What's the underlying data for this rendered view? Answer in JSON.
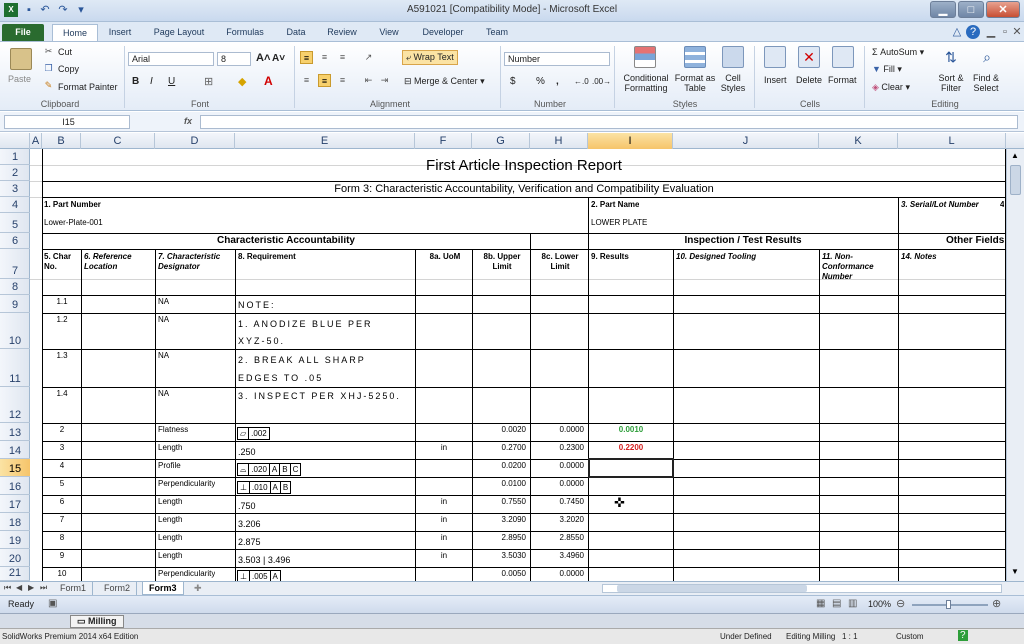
{
  "window": {
    "title": "A591021  [Compatibility Mode]  -  Microsoft Excel"
  },
  "ribbon_tabs": [
    "File",
    "Home",
    "Insert",
    "Page Layout",
    "Formulas",
    "Data",
    "Review",
    "View",
    "Developer",
    "Team"
  ],
  "clipboard": {
    "paste": "Paste",
    "cut": "Cut",
    "copy": "Copy",
    "format_painter": "Format Painter",
    "label": "Clipboard"
  },
  "font": {
    "name": "Arial",
    "size": "8",
    "label": "Font",
    "bold": "B",
    "italic": "I",
    "underline": "U"
  },
  "alignment": {
    "wrap_text": "Wrap Text",
    "merge_center": "Merge & Center",
    "label": "Alignment"
  },
  "number": {
    "format": "Number",
    "label": "Number",
    "currency": "$",
    "percent": "%",
    "comma": ","
  },
  "styles": {
    "conditional": "Conditional Formatting",
    "format_table": "Format as Table",
    "cell_styles": "Cell Styles",
    "label": "Styles"
  },
  "cells": {
    "insert": "Insert",
    "delete": "Delete",
    "format": "Format",
    "label": "Cells"
  },
  "editing": {
    "autosum": "AutoSum",
    "fill": "Fill",
    "clear": "Clear",
    "sort_filter": "Sort & Filter",
    "find_select": "Find & Select",
    "label": "Editing"
  },
  "formula_bar": {
    "name_box": "I15",
    "fx": "fx",
    "value": ""
  },
  "columns": [
    "A",
    "B",
    "C",
    "D",
    "E",
    "F",
    "G",
    "H",
    "I",
    "J",
    "K",
    "L"
  ],
  "rows": [
    "1",
    "2",
    "3",
    "4",
    "5",
    "6",
    "7",
    "8",
    "9",
    "10",
    "11",
    "12",
    "13",
    "14",
    "15",
    "16",
    "17",
    "18",
    "19",
    "20",
    "21"
  ],
  "sheet": {
    "title": "First Article Inspection Report",
    "subtitle": "Form 3: Characteristic Accountability, Verification and Compatibility Evaluation",
    "part_number_label": "1. Part Number",
    "part_number": "Lower-Plate-001",
    "part_name_label": "2. Part Name",
    "part_name": "LOWER PLATE",
    "serial_label": "3. Serial/Lot Number",
    "serial_extra": "4",
    "section_char": "Characteristic Accountability",
    "section_insp": "Inspection / Test Results",
    "section_other": "Other Fields",
    "headers": {
      "char_no": "5. Char No.",
      "ref_loc": "6. Reference Location",
      "char_des": "7. Characteristic Designator",
      "requirement": "8. Requirement",
      "uom": "8a. UoM",
      "upper": "8b. Upper Limit",
      "lower": "8c. Lower Limit",
      "results": "9. Results",
      "tooling": "10. Designed Tooling",
      "nonconf": "11. Non-Conformance Number",
      "notes": "14. Notes"
    },
    "notes_rows": [
      {
        "no": "1.1",
        "des": "NA",
        "req": "NOTE:"
      },
      {
        "no": "1.2",
        "des": "NA",
        "req": "1. ANODIZE BLUE PER",
        "req2": "XYZ-50."
      },
      {
        "no": "1.3",
        "des": "NA",
        "req": "2. BREAK ALL SHARP",
        "req2": "EDGES TO .05"
      },
      {
        "no": "1.4",
        "des": "NA",
        "req": "3. INSPECT PER XHJ-5250."
      }
    ],
    "data_rows": [
      {
        "no": "2",
        "des": "Flatness",
        "gdt": [
          "▱",
          ".002"
        ],
        "uom": "",
        "upper": "0.0020",
        "lower": "0.0000",
        "result": "0.0010",
        "result_color": "#2e9e3a"
      },
      {
        "no": "3",
        "des": "Length",
        "req": ".250",
        "uom": "in",
        "upper": "0.2700",
        "lower": "0.2300",
        "result": "0.2200",
        "result_color": "#d42020"
      },
      {
        "no": "4",
        "des": "Profile",
        "gdt": [
          "⌓",
          ".020",
          "A",
          "B",
          "C"
        ],
        "uom": "",
        "upper": "0.0200",
        "lower": "0.0000",
        "result": ""
      },
      {
        "no": "5",
        "des": "Perpendicularity",
        "gdt": [
          "⊥",
          ".010",
          "A",
          "B"
        ],
        "uom": "",
        "upper": "0.0100",
        "lower": "0.0000",
        "result": ""
      },
      {
        "no": "6",
        "des": "Length",
        "req": ".750",
        "uom": "in",
        "upper": "0.7550",
        "lower": "0.7450",
        "result": ""
      },
      {
        "no": "7",
        "des": "Length",
        "req": "3.206",
        "uom": "in",
        "upper": "3.2090",
        "lower": "3.2020",
        "result": ""
      },
      {
        "no": "8",
        "des": "Length",
        "req": "2.875",
        "uom": "in",
        "upper": "2.8950",
        "lower": "2.8550",
        "result": ""
      },
      {
        "no": "9",
        "des": "Length",
        "req": "3.503  |  3.496",
        "uom": "in",
        "upper": "3.5030",
        "lower": "3.4960",
        "result": ""
      },
      {
        "no": "10",
        "des": "Perpendicularity",
        "gdt": [
          "⊥",
          ".005",
          "A"
        ],
        "uom": "",
        "upper": "0.0050",
        "lower": "0.0000",
        "result": ""
      }
    ]
  },
  "sheet_tabs": [
    "Form1",
    "Form2",
    "Form3"
  ],
  "status": {
    "ready": "Ready",
    "zoom": "100%"
  },
  "taskbar": {
    "item": "Milling"
  },
  "solidworks_bar": {
    "left": "SolidWorks Premium 2014 x64 Edition",
    "status1": "Under Defined",
    "status2": "Editing Milling",
    "scale": "1 : 1",
    "units": "Custom"
  }
}
